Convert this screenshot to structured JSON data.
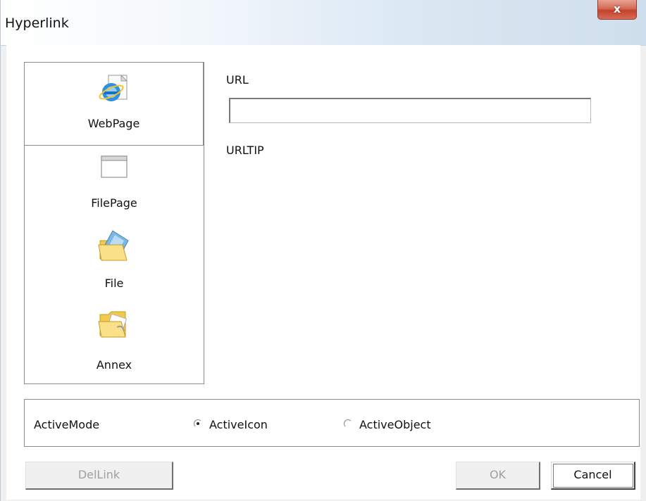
{
  "window": {
    "title": "Hyperlink",
    "close_label": "x"
  },
  "nav": {
    "items": [
      {
        "label": "WebPage",
        "icon": "ie-webpage-icon",
        "selected": true
      },
      {
        "label": "FilePage",
        "icon": "window-page-icon",
        "selected": false
      },
      {
        "label": "File",
        "icon": "folder-file-icon",
        "selected": false
      },
      {
        "label": "Annex",
        "icon": "folder-annex-icon",
        "selected": false
      }
    ]
  },
  "main": {
    "url_label": "URL",
    "url_value": "",
    "urltip_label": "URLTIP"
  },
  "mode": {
    "label": "ActiveMode",
    "options": [
      {
        "label": "ActiveIcon",
        "selected": true
      },
      {
        "label": "ActiveObject",
        "selected": false
      }
    ]
  },
  "buttons": {
    "dellink": "DelLink",
    "ok": "OK",
    "cancel": "Cancel"
  },
  "colors": {
    "close_button": "#c5432c",
    "titlebar_end": "#cfdeec"
  }
}
